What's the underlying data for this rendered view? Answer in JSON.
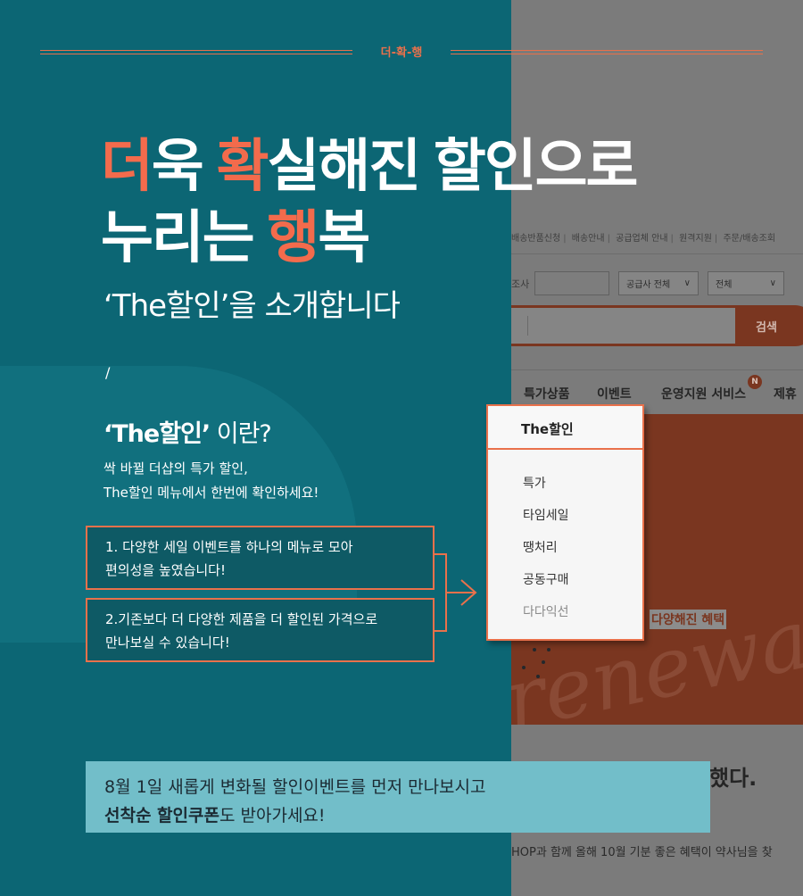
{
  "header": {
    "tag": "더-확-행"
  },
  "headline": {
    "line1_acc1": "더",
    "line1_mid1": "욱 ",
    "line1_acc2": "확",
    "line1_rest": "실해진 할인으로",
    "line2_pre": "누리는 ",
    "line2_acc": "행",
    "line2_post": "복"
  },
  "subtitle": "‘The할인’을 소개합니다",
  "slash": "/",
  "what": {
    "bold": "‘The할인’",
    "rest": " 이란?"
  },
  "description": [
    "싹 바뀔 더샵의 특가 할인,",
    "The할인 메뉴에서 한번에 확인하세요!"
  ],
  "features": [
    {
      "line1": "1. 다양한 세일 이벤트를 하나의 메뉴로 모아",
      "line2": "편의성을 높였습니다!"
    },
    {
      "line1": "2.기존보다 더 다양한 제품을 더 할인된 가격으로",
      "line2": "만나보실 수 있습니다!"
    }
  ],
  "dropdown": {
    "title": "The할인",
    "items": [
      "특가",
      "타임세일",
      "땡처리",
      "공동구매",
      "다다익선"
    ]
  },
  "site": {
    "util_links": [
      "배송반품신청",
      "배송안내",
      "공급업체 안내",
      "원격지원",
      "주문/배송조회"
    ],
    "search_label": "조사",
    "select_supplier": "공급사 전체",
    "select_all": "전체",
    "search_button": "검색",
    "nav": [
      "특가상품",
      "이벤트",
      "운영지원 서비스",
      "제휴"
    ],
    "nav_badge": "N",
    "banner_tag": "다양해진 혜택",
    "banner_script": "renewal",
    "below_title": "했다.",
    "below_line": "HOP과 함께 올해 10월 기분 좋은 혜택이 약사님을 찾"
  },
  "note": {
    "line1": "8월 1일 새롭게 변화될 할인이벤트를 먼저 만나보시고",
    "line2_bold": "선착순 할인쿠폰",
    "line2_rest": "도 받아가세요!"
  },
  "colors": {
    "accent": "#e9714b",
    "teal": "#0c6674",
    "note_bg": "#72bec9"
  }
}
